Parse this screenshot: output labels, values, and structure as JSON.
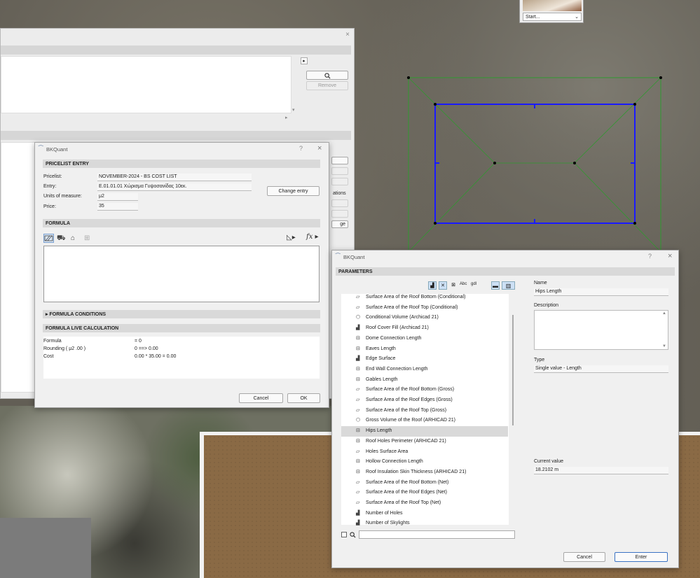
{
  "start_widget": {
    "label": "Start...",
    "chevron": "⌄"
  },
  "back_window": {
    "close": "×",
    "arrow": "▸",
    "remove": "Remove",
    "scroll_down": "▾",
    "scroll_right": "▸",
    "partial_labels": [
      "ations",
      "ge"
    ]
  },
  "entry_dialog": {
    "app_title": "BKQuant",
    "help": "?",
    "close": "×",
    "sections": {
      "pricelist": "PRICELIST ENTRY",
      "formula": "FORMULA",
      "conditions": "FORMULA CONDITIONS",
      "live": "FORMULA LIVE CALCULATION"
    },
    "fields": {
      "pricelist_label": "Pricelist:",
      "pricelist_value": "NOVEMBER-2024  -  BS COST LIST",
      "entry_label": "Entry:",
      "entry_value": "E.01.01.01  Χώρισμα Γυψοσανίδας 10εκ.",
      "units_label": "Units of measure:",
      "units_value": "μ2",
      "price_label": "Price:",
      "price_value": "35"
    },
    "change_entry": "Change entry",
    "fx_label": "fx",
    "live_rows": [
      {
        "name": "Formula",
        "value": "= 0"
      },
      {
        "name": "Rounding ( μ2  .00 )",
        "value": "0  ==>  0.00"
      },
      {
        "name": "Cost",
        "value": "0.00 * 35.00 = 0.00"
      }
    ],
    "cancel": "Cancel",
    "ok": "OK"
  },
  "param_dialog": {
    "app_title": "BKQuant",
    "help": "?",
    "close": "×",
    "section": "PARAMETERS",
    "toolbar_text": {
      "abc": "Abc",
      "gdl": "gdl"
    },
    "items": [
      {
        "icon": "surface-icon",
        "glyph": "▱",
        "label": "Surface Area of the Roof Bottom (Conditional)"
      },
      {
        "icon": "surface-icon",
        "glyph": "▱",
        "label": "Surface Area of the Roof Top (Conditional)"
      },
      {
        "icon": "volume-icon",
        "glyph": "⬡",
        "label": "Conditional Volume (Archicad 21)"
      },
      {
        "icon": "fill-icon",
        "glyph": "▟",
        "label": "Roof Cover Fill (Archicad 21)"
      },
      {
        "icon": "length-icon",
        "glyph": "⊟",
        "label": "Dome Connection Length"
      },
      {
        "icon": "length-icon",
        "glyph": "⊟",
        "label": "Eaves Length"
      },
      {
        "icon": "fill-icon",
        "glyph": "▟",
        "label": "Edge Surface"
      },
      {
        "icon": "length-icon",
        "glyph": "⊟",
        "label": "End Wall Connection Length"
      },
      {
        "icon": "length-icon",
        "glyph": "⊟",
        "label": "Gables Length"
      },
      {
        "icon": "surface-icon",
        "glyph": "▱",
        "label": "Surface Area of the Roof Bottom (Gross)"
      },
      {
        "icon": "surface-icon",
        "glyph": "▱",
        "label": "Surface Area of the Roof Edges (Gross)"
      },
      {
        "icon": "surface-icon",
        "glyph": "▱",
        "label": "Surface Area of the Roof Top (Gross)"
      },
      {
        "icon": "volume-icon",
        "glyph": "⬡",
        "label": "Gross Volume of the Roof (ARHICAD 21)"
      },
      {
        "icon": "length-icon",
        "glyph": "⊟",
        "label": "Hips Length"
      },
      {
        "icon": "length-icon",
        "glyph": "⊟",
        "label": "Roof Holes Perimeter (ARHICAD 21)"
      },
      {
        "icon": "surface-icon",
        "glyph": "▱",
        "label": "Holes Surface Area"
      },
      {
        "icon": "length-icon",
        "glyph": "⊟",
        "label": "Hollow Connection Length"
      },
      {
        "icon": "length-icon",
        "glyph": "⊟",
        "label": "Roof Insulation Skin Thickness (ARHICAD 21)"
      },
      {
        "icon": "surface-icon",
        "glyph": "▱",
        "label": "Surface Area of the Roof Bottom (Net)"
      },
      {
        "icon": "surface-icon",
        "glyph": "▱",
        "label": "Surface Area of the Roof Edges (Net)"
      },
      {
        "icon": "surface-icon",
        "glyph": "▱",
        "label": "Surface Area of the Roof Top (Net)"
      },
      {
        "icon": "count-icon",
        "glyph": "▟",
        "label": "Number of Holes"
      },
      {
        "icon": "count-icon",
        "glyph": "▟",
        "label": "Number of Skylights"
      }
    ],
    "selected_index": 13,
    "name_label": "Name",
    "name_value": "Hips Length",
    "description_label": "Description",
    "type_label": "Type",
    "type_value": "Single value - Length",
    "current_label": "Current value",
    "current_value": "18.2102 m",
    "search_value": "",
    "cancel": "Cancel",
    "enter": "Enter"
  }
}
